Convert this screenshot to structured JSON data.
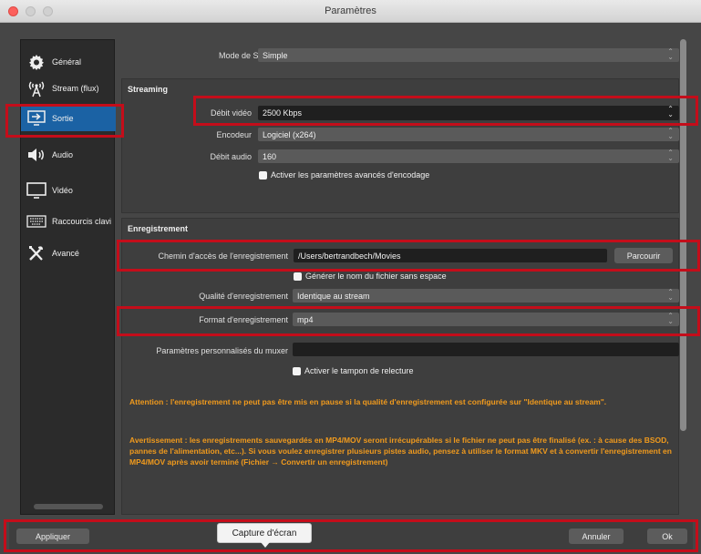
{
  "window": {
    "title": "Paramètres"
  },
  "sidebar": {
    "items": [
      {
        "label": "Général",
        "icon": "gear-icon"
      },
      {
        "label": "Stream (flux)",
        "icon": "broadcast-icon"
      },
      {
        "label": "Sortie",
        "icon": "output-icon"
      },
      {
        "label": "Audio",
        "icon": "speaker-icon"
      },
      {
        "label": "Vidéo",
        "icon": "monitor-icon"
      },
      {
        "label": "Raccourcis clavi",
        "icon": "keyboard-icon"
      },
      {
        "label": "Avancé",
        "icon": "tools-icon"
      }
    ],
    "active": "Sortie"
  },
  "output_mode": {
    "label": "Mode de Sortie",
    "value": "Simple"
  },
  "streaming": {
    "title": "Streaming",
    "video_bitrate": {
      "label": "Débit vidéo",
      "value": "2500 Kbps"
    },
    "encoder": {
      "label": "Encodeur",
      "value": "Logiciel (x264)"
    },
    "audio_bitrate": {
      "label": "Débit audio",
      "value": "160"
    },
    "advanced_checkbox": "Activer les paramètres avancés d'encodage"
  },
  "recording": {
    "title": "Enregistrement",
    "path": {
      "label": "Chemin d'accès de l'enregistrement",
      "value": "/Users/bertrandbech/Movies",
      "browse": "Parcourir"
    },
    "no_space_checkbox": "Générer le nom du fichier sans espace",
    "quality": {
      "label": "Qualité d'enregistrement",
      "value": "Identique au stream"
    },
    "format": {
      "label": "Format d'enregistrement",
      "value": "mp4"
    },
    "muxer": {
      "label": "Paramètres personnalisés du muxer",
      "value": ""
    },
    "replay_checkbox": "Activer le tampon de relecture"
  },
  "warnings": {
    "pause": "Attention : l'enregistrement ne peut pas être mis en pause si la qualité d'enregistrement est configurée sur \"Identique au stream\".",
    "mp4": "Avertissement : les enregistrements sauvegardés en MP4/MOV seront irrécupérables si le fichier ne peut pas être finalisé (ex. : à cause des BSOD, pannes de l'alimentation, etc...). Si vous voulez enregistrer plusieurs pistes audio, pensez à utiliser le format MKV et à convertir l'enregistrement en MP4/MOV après avoir terminé (Fichier → Convertir un enregistrement)"
  },
  "footer": {
    "apply": "Appliquer",
    "tooltip": "Capture d'écran",
    "cancel": "Annuler",
    "ok": "Ok"
  },
  "colors": {
    "highlight": "#c40d1a",
    "warning": "#f09a1d",
    "accent": "#1b62a4"
  }
}
